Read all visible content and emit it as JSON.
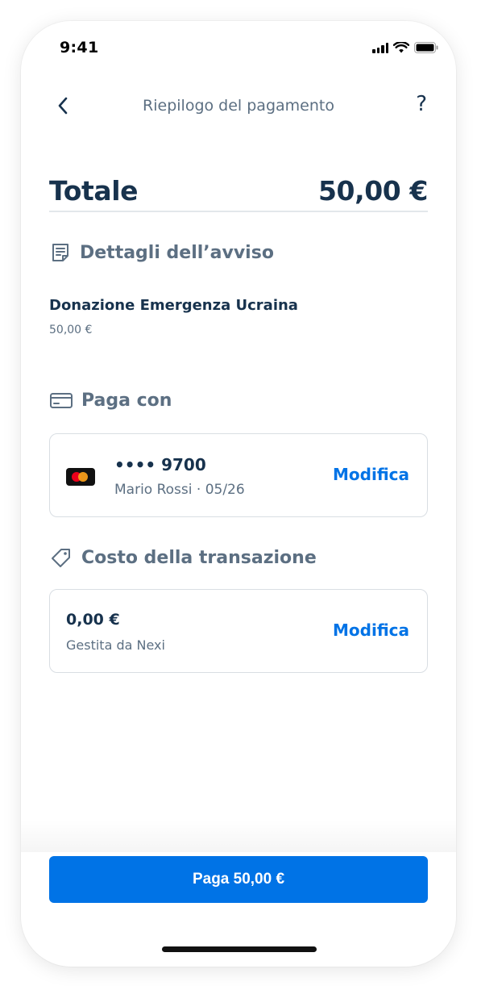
{
  "status_bar": {
    "time": "9:41"
  },
  "header": {
    "title": "Riepilogo del pagamento",
    "back_icon": "chevron-left-icon",
    "help_label": "?"
  },
  "total": {
    "label": "Totale",
    "value": "50,00 €"
  },
  "notice_section": {
    "title": "Dettagli dell’avviso",
    "icon": "document-icon",
    "name": "Donazione Emergenza Ucraina",
    "amount": "50,00 €"
  },
  "payment_section": {
    "title": "Paga con",
    "icon": "credit-card-icon",
    "card_number": "•••• 9700",
    "card_holder": "Mario Rossi · 05/26",
    "card_brand_icon": "mastercard-icon",
    "edit_label": "Modifica"
  },
  "fee_section": {
    "title": "Costo della transazione",
    "icon": "tag-icon",
    "amount": "0,00 €",
    "provider": "Gestita da Nexi",
    "edit_label": "Modifica"
  },
  "pay_button": {
    "label": "Paga 50,00 €"
  },
  "colors": {
    "primary": "#0073e6",
    "text": "#17324d",
    "muted": "#5c6f82",
    "border": "#d9dee3"
  }
}
